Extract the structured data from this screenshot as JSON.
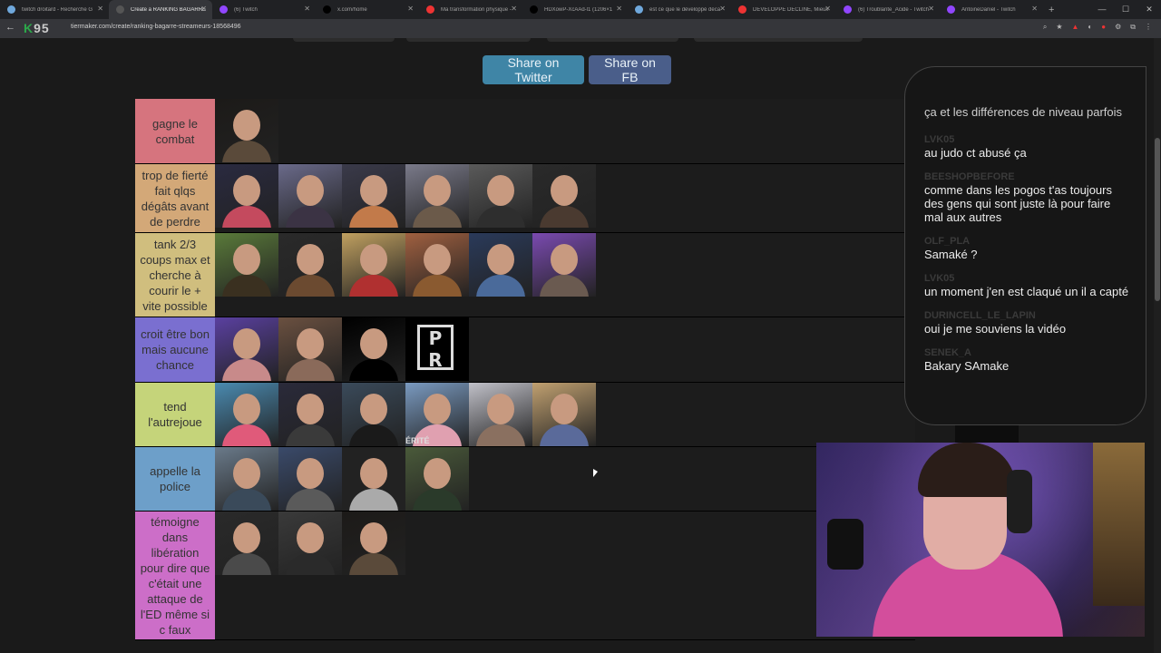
{
  "browser": {
    "tabs": [
      {
        "title": "twitch droitard - Recherche G",
        "fav": "#6fa8dc",
        "active": false
      },
      {
        "title": "Create a RANKING BAGARRE",
        "fav": "#555",
        "active": true
      },
      {
        "title": "(6) Twitch",
        "fav": "#9146ff",
        "active": false
      },
      {
        "title": "x.com/home",
        "fav": "#000",
        "active": false
      },
      {
        "title": "Ma transformation physique -",
        "fav": "#e33",
        "active": false
      },
      {
        "title": "HDXowP-XcAAd-l1 (1206×1",
        "fav": "#000",
        "active": false
      },
      {
        "title": "est ce que le développé déca",
        "fav": "#6fa8dc",
        "active": false
      },
      {
        "title": "DÉVELOPPÉ DÉCLINÉ, Mieux",
        "fav": "#e33",
        "active": false
      },
      {
        "title": "(6) Troublante_Acide - Twitch",
        "fav": "#9146ff",
        "active": false
      },
      {
        "title": "AntoineDaniel - Twitch",
        "fav": "#9146ff",
        "active": false
      }
    ],
    "new_tab": "+",
    "url": "tiermaker.com/create/ranking-bagarre-streameurs-18568496",
    "logo": {
      "k": "K",
      "rest": "95"
    },
    "back": "←",
    "tools": [
      "⌕",
      "★",
      "▲",
      "◐",
      "●",
      "⚙",
      "⧉",
      "⋮"
    ],
    "window": [
      "—",
      "☐",
      "✕"
    ]
  },
  "page": {
    "share_twitter": "Share on Twitter",
    "share_fb": "Share on FB"
  },
  "tiers": [
    {
      "label": "gagne le combat",
      "color": "#d6747e",
      "count": 1
    },
    {
      "label": "trop de fierté fait qlqs dégâts avant de perdre",
      "color": "#d3a878",
      "count": 6
    },
    {
      "label": "tank 2/3 coups max et cherche à courir le + vite possible",
      "color": "#d0be7e",
      "count": 6
    },
    {
      "label": "croit être bon mais aucune chance",
      "color": "#7a6fd0",
      "count": 4
    },
    {
      "label": "tend l'autrejoue",
      "color": "#c5d47a",
      "count": 6
    },
    {
      "label": "appelle la police",
      "color": "#6d9fc9",
      "count": 4
    },
    {
      "label": "témoigne dans libération pour dire que c'était une attaque de l'ED même si c faux",
      "color": "#cc6ec8",
      "count": 3
    }
  ],
  "chat": {
    "first": "ça et les différences de niveau parfois",
    "messages": [
      {
        "user": "LVK05",
        "text": "au judo ct abusé ça"
      },
      {
        "user": "BEESHOPBEFORE",
        "text": "comme dans les pogos t'as toujours des gens qui sont juste là pour faire mal aux autres"
      },
      {
        "user": "OLF_PLA",
        "text": "Samaké ?"
      },
      {
        "user": "LVK05",
        "text": "un moment j'en est claqué un il a capté"
      },
      {
        "user": "DURINCELL_LE_LAPIN",
        "text": "oui je me souviens la vidéo"
      },
      {
        "user": "SENEK_A",
        "text": "Bakary SAmake"
      }
    ]
  },
  "avatar_tile_label": "ÉRITÉ"
}
